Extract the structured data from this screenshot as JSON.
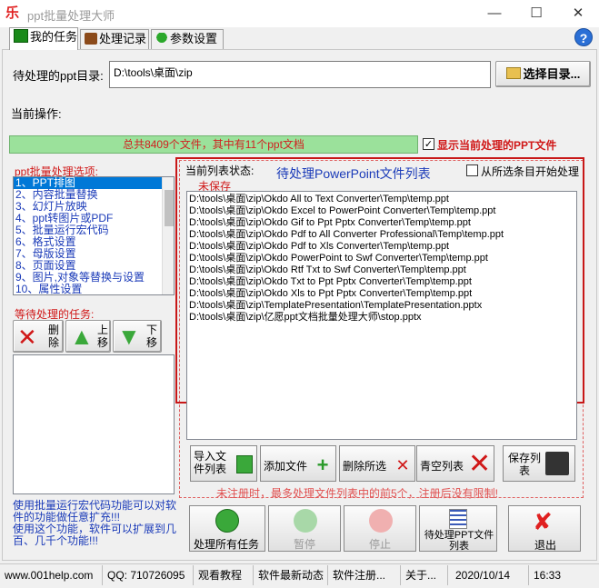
{
  "window": {
    "title": "ppt批量处理大师",
    "icon_glyph": "乐"
  },
  "tabs": [
    {
      "label": "我的任务"
    },
    {
      "label": "处理记录"
    },
    {
      "label": "参数设置"
    }
  ],
  "dir": {
    "label": "待处理的ppt目录:",
    "value": "D:\\tools\\桌面\\zip",
    "select_button": "选择目录..."
  },
  "current_op": {
    "label": "当前操作:"
  },
  "progress": {
    "text": "总共8409个文件，其中有11个ppt文档"
  },
  "show_current": {
    "label": "显示当前处理的PPT文件",
    "checked": true
  },
  "options": {
    "label": "ppt批量处理选项:",
    "items": [
      "1、PPT排图",
      "2、内容批量替换",
      "3、幻灯片放映",
      "4、ppt转图片或PDF",
      "5、批量运行宏代码",
      "6、格式设置",
      "7、母版设置",
      "8、页面设置",
      "9、图片,对象等替换与设置",
      "10、属性设置"
    ],
    "selected_index": 0
  },
  "pending": {
    "label": "等待处理的任务:",
    "delete": "删\n除",
    "up": "上\n移",
    "down": "下\n移"
  },
  "list_status": {
    "label": "当前列表状态:",
    "state": "未保存",
    "title": "待处理PowerPoint文件列表",
    "start_from_selected": "从所选条目开始处理"
  },
  "files": [
    "D:\\tools\\桌面\\zip\\Okdo All to Text Converter\\Temp\\temp.ppt",
    "D:\\tools\\桌面\\zip\\Okdo Excel to PowerPoint Converter\\Temp\\temp.ppt",
    "D:\\tools\\桌面\\zip\\Okdo Gif to Ppt Pptx Converter\\Temp\\temp.ppt",
    "D:\\tools\\桌面\\zip\\Okdo Pdf to All Converter Professional\\Temp\\temp.ppt",
    "D:\\tools\\桌面\\zip\\Okdo Pdf to Xls Converter\\Temp\\temp.ppt",
    "D:\\tools\\桌面\\zip\\Okdo PowerPoint to Swf Converter\\Temp\\temp.ppt",
    "D:\\tools\\桌面\\zip\\Okdo Rtf Txt to Swf Converter\\Temp\\temp.ppt",
    "D:\\tools\\桌面\\zip\\Okdo Txt to Ppt Pptx Converter\\Temp\\temp.ppt",
    "D:\\tools\\桌面\\zip\\Okdo Xls to Ppt Pptx Converter\\Temp\\temp.ppt",
    "D:\\tools\\桌面\\zip\\TemplatePresentation\\TemplatePresentation.pptx",
    "D:\\tools\\桌面\\zip\\亿愿ppt文档批量处理大师\\stop.pptx"
  ],
  "list_buttons": {
    "import": "导入文\n件列表",
    "add": "添加文件",
    "delete_selected": "删除所选",
    "clear": "青空列表",
    "save": "保存列\n表"
  },
  "unreg_notice": "未注册时，最多处理文件列表中的前5个，注册后没有限制!",
  "macro_tip": "使用批量运行宏代码功能可以对软件的功能做任意扩充!!!\n使用这个功能，软件可以扩展到几百、几千个功能!!!",
  "actions": {
    "process_all": "处理所有任务",
    "pause": "暂停",
    "stop": "停止",
    "pending_list": "待处理PPT文件\n列表",
    "exit": "退出"
  },
  "statusbar": {
    "site": "www.001help.com",
    "qq": "QQ:  710726095",
    "tutorial": "观看教程",
    "news": "软件最新动态",
    "register": "软件注册...",
    "about": "关于...",
    "date": "2020/10/14",
    "time": "16:33"
  },
  "colors": {
    "accent_red": "#c81818",
    "link_blue": "#1a3ab8",
    "progress_green": "#9be19b"
  }
}
